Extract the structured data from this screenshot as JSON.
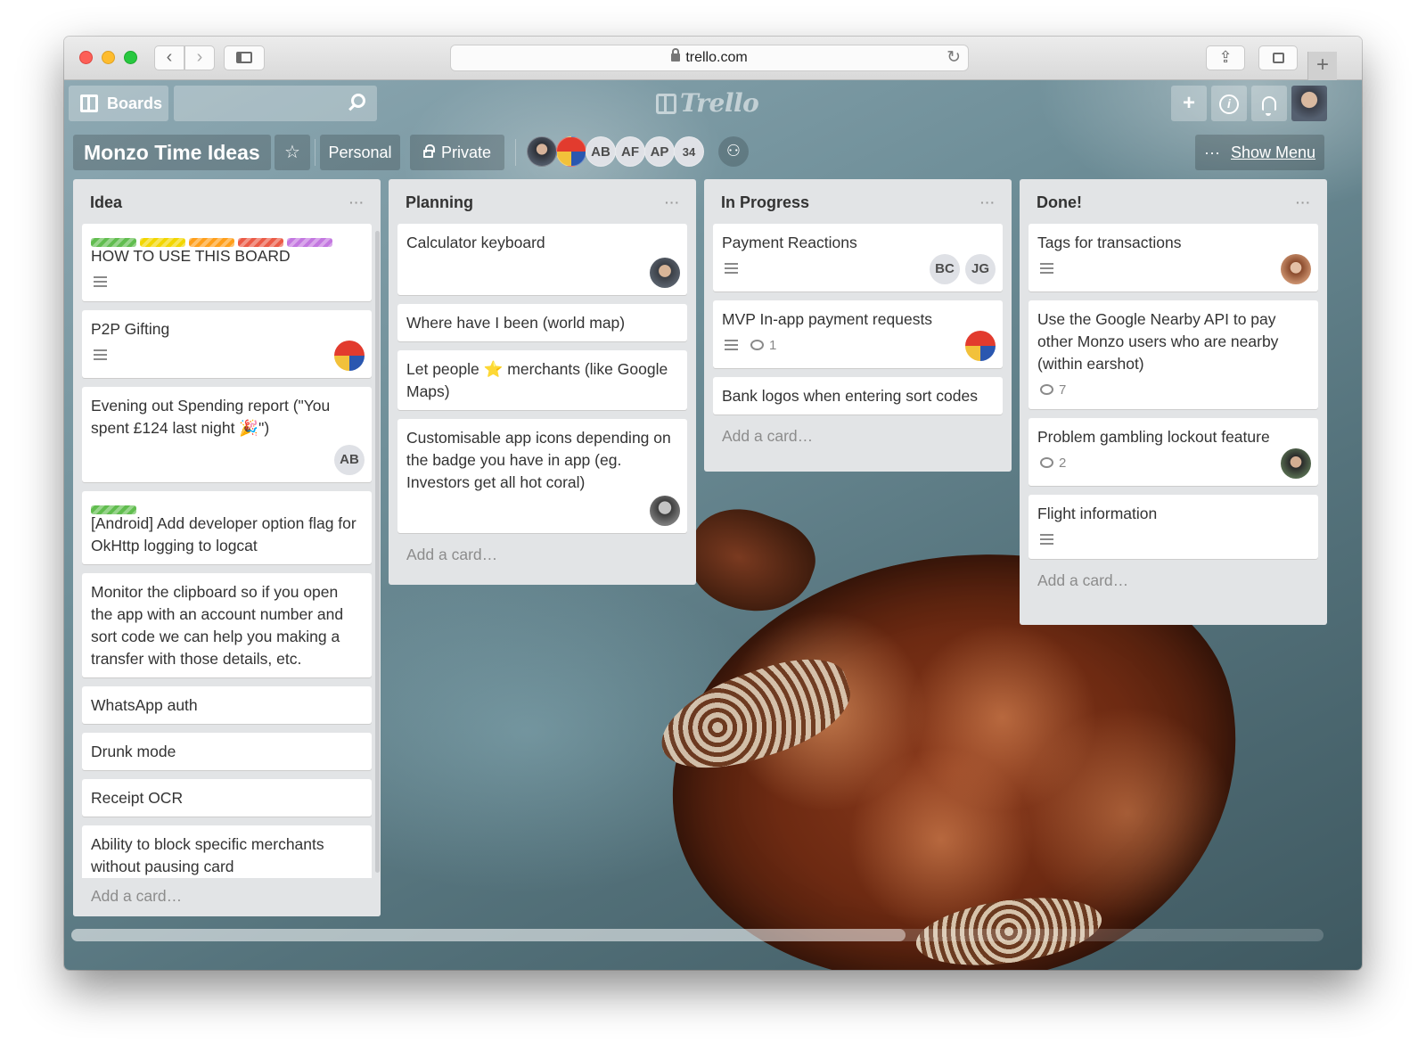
{
  "browser": {
    "url": "trello.com"
  },
  "header": {
    "boards_label": "Boards",
    "logo_text": "Trello",
    "add_label": "+"
  },
  "board": {
    "title": "Monzo Time Ideas",
    "star_symbol": "☆",
    "team_label": "Personal",
    "visibility_label": "Private",
    "members": [
      "AB",
      "AF",
      "AP"
    ],
    "member_count": "34",
    "show_menu_dots": "···",
    "show_menu_label": "Show Menu"
  },
  "lists": [
    {
      "title": "Idea",
      "menu": "···",
      "add_card": "Add a card…",
      "cards": [
        {
          "title": "HOW TO USE THIS BOARD",
          "labels": [
            "#61bd4f",
            "#f2d600",
            "#ff9f1a",
            "#eb5a46",
            "#c377e0"
          ]
        },
        {
          "title": "P2P Gifting"
        },
        {
          "title": "Evening out Spending report (\"You spent £124 last night 🎉\")",
          "member": "AB"
        },
        {
          "title": "[Android] Add developer option flag for OkHttp logging to logcat",
          "labels": [
            "#61bd4f"
          ]
        },
        {
          "title": "Monitor the clipboard so if you open the app with an account number and sort code we can help you making a transfer with those details, etc."
        },
        {
          "title": "WhatsApp auth"
        },
        {
          "title": "Drunk mode"
        },
        {
          "title": "Receipt OCR"
        },
        {
          "title": "Ability to block specific merchants without pausing card"
        }
      ]
    },
    {
      "title": "Planning",
      "menu": "···",
      "add_card": "Add a card…",
      "cards": [
        {
          "title": "Calculator keyboard"
        },
        {
          "title": "Where have I been (world map)"
        },
        {
          "title": "Let people ⭐️ merchants (like Google Maps)"
        },
        {
          "title": "Customisable app icons depending on the badge you have in app (eg. Investors get all hot coral)"
        }
      ]
    },
    {
      "title": "In Progress",
      "menu": "···",
      "add_card": "Add a card…",
      "cards": [
        {
          "title": "Payment Reactions",
          "members": [
            "BC",
            "JG"
          ]
        },
        {
          "title": "MVP In-app payment requests",
          "comments": "1"
        },
        {
          "title": "Bank logos when entering sort codes"
        }
      ]
    },
    {
      "title": "Done!",
      "menu": "···",
      "add_card": "Add a card…",
      "cards": [
        {
          "title": "Tags for transactions"
        },
        {
          "title": "Use the Google Nearby API to pay other Monzo users who are nearby (within earshot)",
          "comments": "7"
        },
        {
          "title": "Problem gambling lockout feature",
          "comments": "2"
        },
        {
          "title": "Flight information"
        }
      ]
    }
  ]
}
